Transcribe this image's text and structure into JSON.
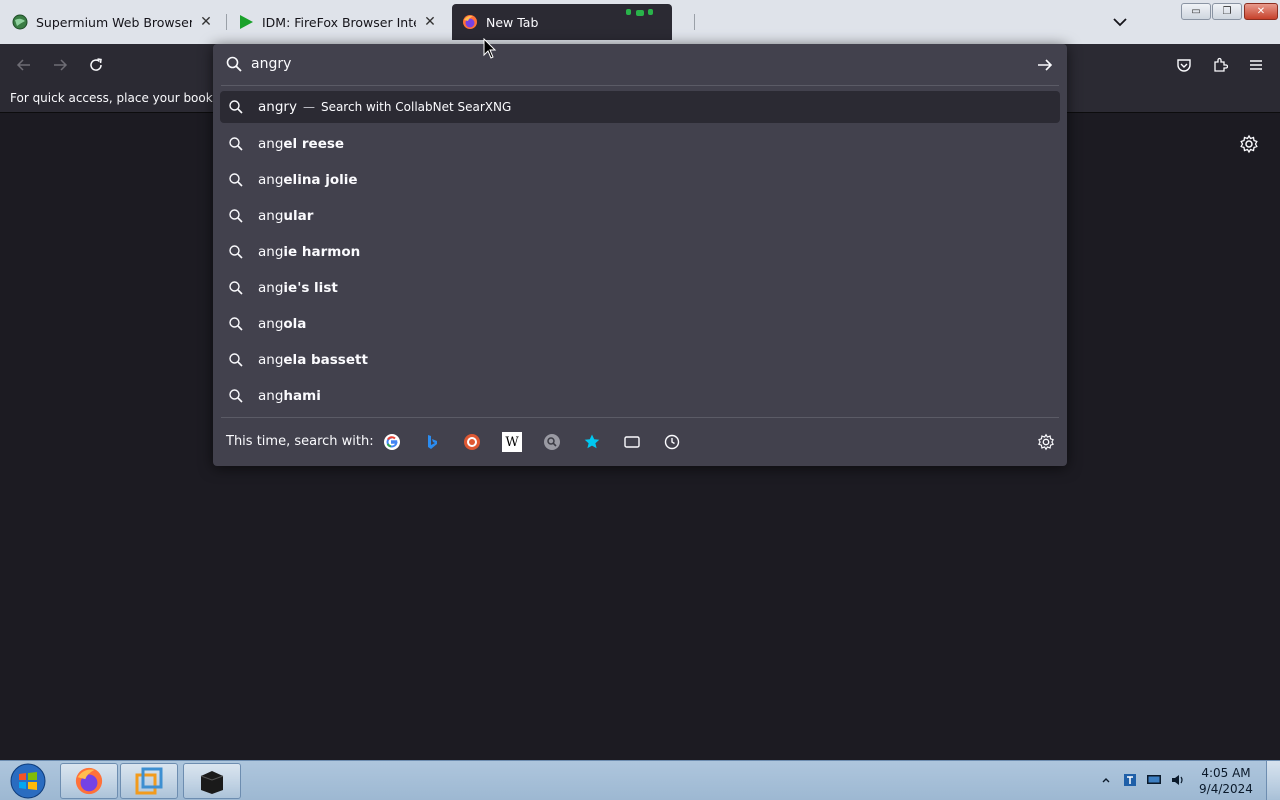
{
  "tabs": [
    {
      "title": "Supermium Web Browser",
      "close": "✕",
      "icon": "supermium-globe-icon"
    },
    {
      "title": "IDM: FireFox Browser Integratio",
      "close": "✕",
      "icon": "idm-play-icon"
    },
    {
      "title": "New Tab",
      "icon": "firefox-icon"
    }
  ],
  "tablist_icon": "chevron-down-icon",
  "window_controls": {
    "minimize": "▭",
    "maximize": "❐",
    "close": "✕"
  },
  "bookmarks_bar": {
    "text": "For quick access, place your bookmarks here on the bookmarks toolbar."
  },
  "urlbar": {
    "value": "angry"
  },
  "results": [
    {
      "typed": "angry",
      "suffix": "",
      "dash": "—",
      "action": "Search with CollabNet SearXNG",
      "selected": true
    },
    {
      "typed": "ang",
      "suffix": "el reese"
    },
    {
      "typed": "ang",
      "suffix": "elina jolie"
    },
    {
      "typed": "ang",
      "suffix": "ular"
    },
    {
      "typed": "ang",
      "suffix": "ie harmon"
    },
    {
      "typed": "ang",
      "suffix": "ie's list"
    },
    {
      "typed": "ang",
      "suffix": "ola"
    },
    {
      "typed": "ang",
      "suffix": "ela bassett"
    },
    {
      "typed": "ang",
      "suffix": "hami"
    }
  ],
  "oneoff": {
    "label": "This time, search with:",
    "engines": [
      "google-icon",
      "bing-icon",
      "duckduckgo-icon",
      "wikipedia-icon",
      "searxng-icon",
      "bookmarks-star-icon",
      "tabs-icon",
      "history-icon"
    ],
    "wikipedia_glyph": "W"
  },
  "taskbar": {
    "time": "4:05 AM",
    "date": "9/4/2024"
  },
  "colors": {
    "panel": "#42414d",
    "toolbar": "#2b2a33",
    "content": "#1c1b22",
    "accent_star": "#00c8f0"
  }
}
